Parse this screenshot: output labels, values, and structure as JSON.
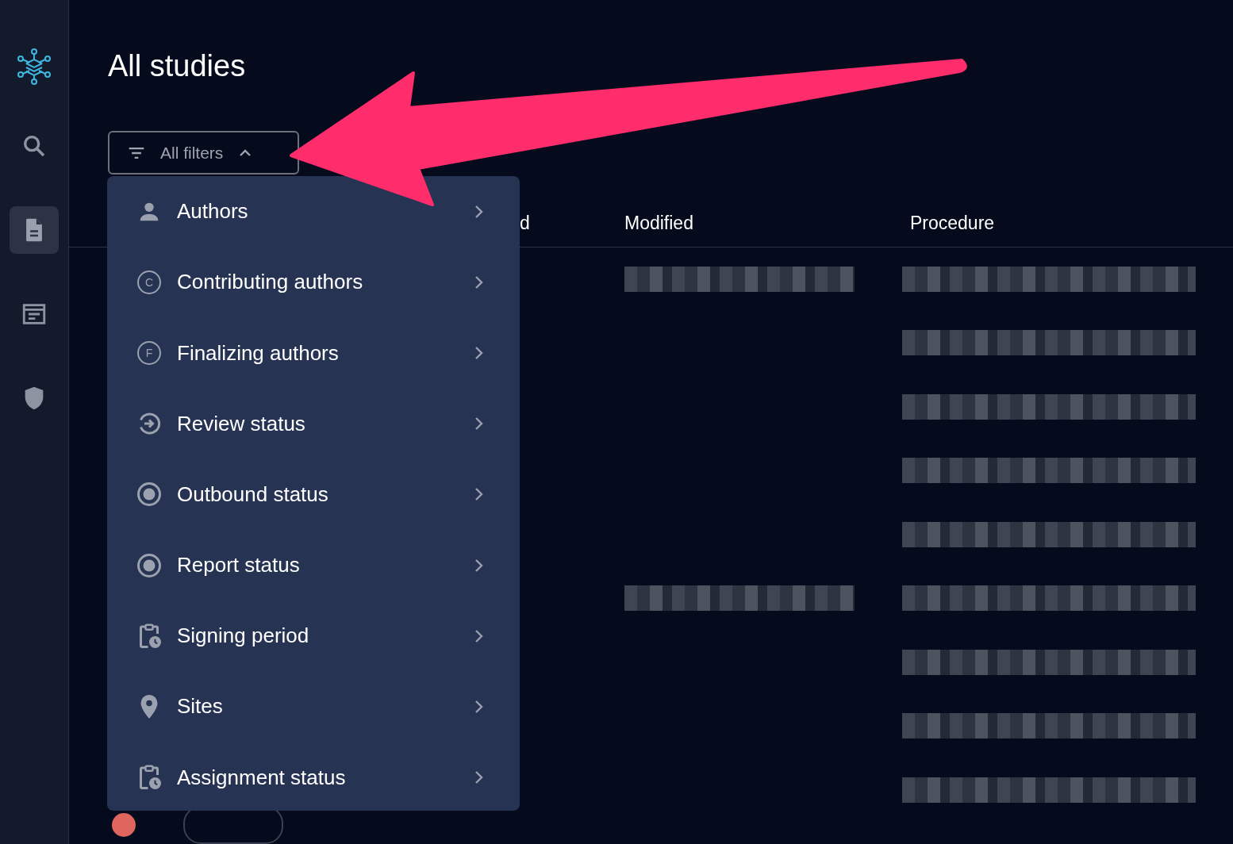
{
  "sidebar": {
    "items": [
      {
        "kind": "search",
        "selected": false
      },
      {
        "kind": "document",
        "selected": true
      },
      {
        "kind": "article",
        "selected": false
      },
      {
        "kind": "shield",
        "selected": false
      }
    ]
  },
  "page": {
    "title": "All studies"
  },
  "filter_button": {
    "label": "All filters",
    "expanded": true
  },
  "filter_menu": [
    {
      "label": "Authors",
      "kind": "person"
    },
    {
      "label": "Contributing authors",
      "kind": "letter",
      "letter": "C"
    },
    {
      "label": "Finalizing authors",
      "kind": "letter",
      "letter": "F"
    },
    {
      "label": "Review status",
      "kind": "cycle"
    },
    {
      "label": "Outbound status",
      "kind": "radio"
    },
    {
      "label": "Report status",
      "kind": "radio"
    },
    {
      "label": "Signing period",
      "kind": "clipboard"
    },
    {
      "label": "Sites",
      "kind": "pin"
    },
    {
      "label": "Assignment status",
      "kind": "clipboard"
    }
  ],
  "table": {
    "columns": [
      "d",
      "Modified",
      "Procedure"
    ],
    "rows": [
      {
        "modified_redacted": true,
        "procedure_redacted": true
      },
      {
        "modified_redacted": false,
        "procedure_redacted": true
      },
      {
        "modified_redacted": false,
        "procedure_redacted": true
      },
      {
        "modified_redacted": false,
        "procedure_redacted": true
      },
      {
        "modified_redacted": false,
        "procedure_redacted": true
      },
      {
        "modified_redacted": true,
        "procedure_redacted": true
      },
      {
        "modified_redacted": false,
        "procedure_redacted": true
      },
      {
        "modified_redacted": false,
        "procedure_redacted": true
      },
      {
        "modified_redacted": false,
        "procedure_redacted": true
      }
    ]
  }
}
